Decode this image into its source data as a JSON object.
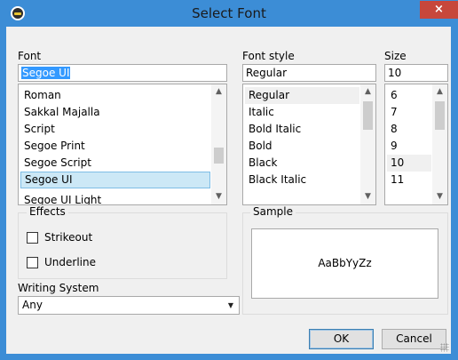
{
  "window": {
    "title": "Select Font",
    "close_glyph": "×"
  },
  "font": {
    "label": "Font",
    "value": "Segoe UI",
    "items": [
      "Roman",
      "Sakkal Majalla",
      "Script",
      "Segoe Print",
      "Segoe Script",
      "Segoe UI"
    ],
    "selected": "Segoe UI",
    "cut_off_item": "Segoe UI Light"
  },
  "font_style": {
    "label": "Font style",
    "value": "Regular",
    "items": [
      "Regular",
      "Italic",
      "Bold Italic",
      "Bold",
      "Black",
      "Black Italic"
    ],
    "selected": "Regular"
  },
  "size": {
    "label": "Size",
    "value": "10",
    "items": [
      "6",
      "7",
      "8",
      "9",
      "10",
      "11"
    ],
    "selected": "10"
  },
  "effects": {
    "label": "Effects",
    "strikeout_label": "Strikeout",
    "underline_label": "Underline",
    "strikeout_checked": false,
    "underline_checked": false
  },
  "writing_system": {
    "label": "Writing System",
    "value": "Any"
  },
  "sample": {
    "label": "Sample",
    "text": "AaBbYyZz"
  },
  "buttons": {
    "ok": "OK",
    "cancel": "Cancel"
  },
  "icons": {
    "scroll_up": "▲",
    "scroll_down": "▼",
    "combo_caret": "▼"
  }
}
